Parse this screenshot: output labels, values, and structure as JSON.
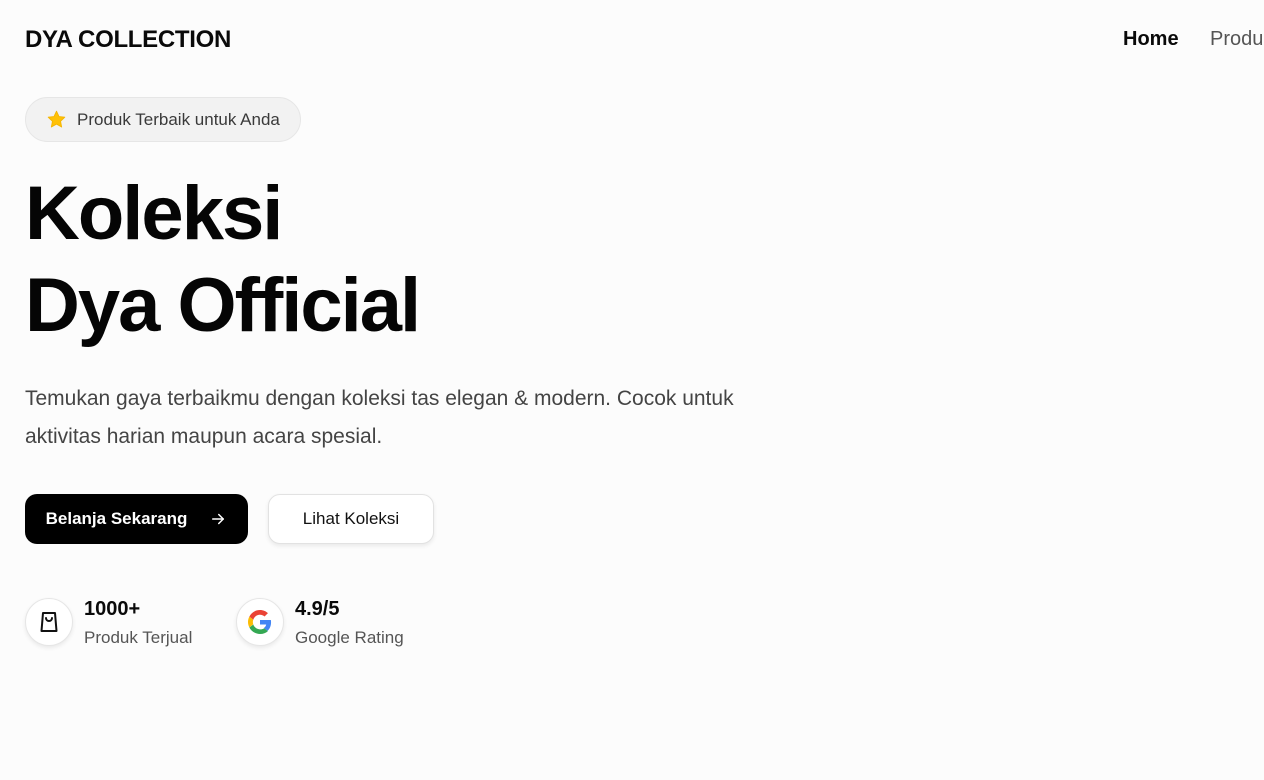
{
  "header": {
    "brand": "DYA COLLECTION",
    "nav": [
      {
        "label": "Home",
        "active": true
      },
      {
        "label": "Produk",
        "active": false
      }
    ]
  },
  "hero": {
    "badge": {
      "icon": "star-icon",
      "text": "Produk Terbaik untuk Anda",
      "icon_color": "#FFC107"
    },
    "title_line1": "Koleksi",
    "title_line2": "Dya Official",
    "description": "Temukan gaya terbaikmu dengan koleksi tas elegan & modern. Cocok untuk aktivitas harian maupun acara spesial.",
    "primary_button": {
      "label": "Belanja Sekarang",
      "icon": "arrow-right-icon"
    },
    "secondary_button": {
      "label": "Lihat Koleksi"
    }
  },
  "stats": [
    {
      "icon": "shopping-bag-icon",
      "value": "1000+",
      "label": "Produk Terjual"
    },
    {
      "icon": "google-logo-icon",
      "value": "4.9/5",
      "label": "Google Rating"
    }
  ],
  "colors": {
    "background": "#FCFCFC",
    "primary": "#000000",
    "text": "#0A0A0A",
    "muted": "#555555",
    "star": "#FFC107"
  }
}
